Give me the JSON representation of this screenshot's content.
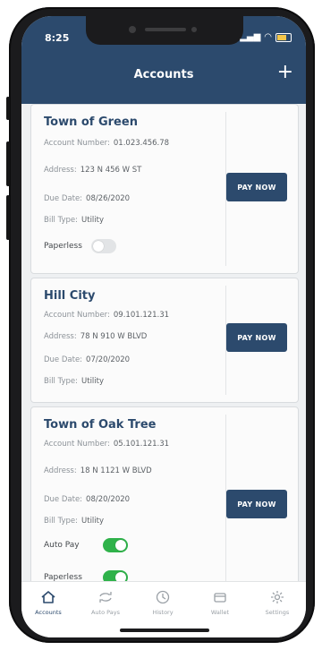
{
  "status": {
    "time": "8:25"
  },
  "header": {
    "title": "Accounts",
    "add_label": "+"
  },
  "accounts": [
    {
      "name": "Town of Green",
      "account_label": "Account Number:",
      "account_number": "01.023.456.78",
      "address_label": "Address:",
      "address": "123 N 456 W ST",
      "due_label": "Due Date:",
      "due_date": "08/26/2020",
      "type_label": "Bill Type:",
      "bill_type": "Utility",
      "pay_label": "PAY NOW",
      "paperless_label": "Paperless",
      "paperless": false
    },
    {
      "name": "Hill City",
      "account_label": "Account Number:",
      "account_number": "09.101.121.31",
      "address_label": "Address:",
      "address": "78 N 910 W BLVD",
      "due_label": "Due Date:",
      "due_date": "07/20/2020",
      "type_label": "Bill Type:",
      "bill_type": "Utility",
      "pay_label": "PAY NOW"
    },
    {
      "name": "Town of Oak Tree",
      "account_label": "Account Number:",
      "account_number": "05.101.121.31",
      "address_label": "Address:",
      "address": "18 N 1121 W BLVD",
      "due_label": "Due Date:",
      "due_date": "08/20/2020",
      "type_label": "Bill Type:",
      "bill_type": "Utility",
      "pay_label": "PAY NOW",
      "autopay_label": "Auto Pay",
      "autopay": true,
      "paperless_label": "Paperless",
      "paperless": true
    }
  ],
  "tabs": [
    {
      "label": "Accounts",
      "icon": "home-icon",
      "active": true
    },
    {
      "label": "Auto Pays",
      "icon": "repeat-icon",
      "active": false
    },
    {
      "label": "History",
      "icon": "clock-icon",
      "active": false
    },
    {
      "label": "Wallet",
      "icon": "wallet-icon",
      "active": false
    },
    {
      "label": "Settings",
      "icon": "gear-icon",
      "active": false
    }
  ],
  "colors": {
    "brand": "#2c4a6d",
    "toggle_on": "#2fb24a",
    "toggle_off": "#e2e4e6"
  }
}
